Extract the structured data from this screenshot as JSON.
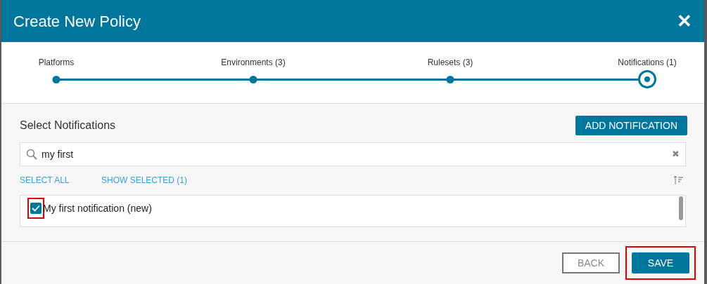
{
  "dialog": {
    "title": "Create New Policy",
    "close_icon": "✕"
  },
  "steps": [
    {
      "label": "Platforms",
      "current": false
    },
    {
      "label": "Environments (3)",
      "current": false
    },
    {
      "label": "Rulesets (3)",
      "current": false
    },
    {
      "label": "Notifications (1)",
      "current": true
    }
  ],
  "section_title": "Select Notifications",
  "add_button": "ADD NOTIFICATION",
  "search": {
    "value": "my first",
    "clear": "✖"
  },
  "links": [
    "SELECT ALL",
    "SHOW SELECTED (1)"
  ],
  "items": [
    {
      "label": "My first notification (new)",
      "checked": true,
      "highlighted": true
    }
  ],
  "footer": {
    "back": "BACK",
    "save": "SAVE",
    "save_highlighted": true
  }
}
